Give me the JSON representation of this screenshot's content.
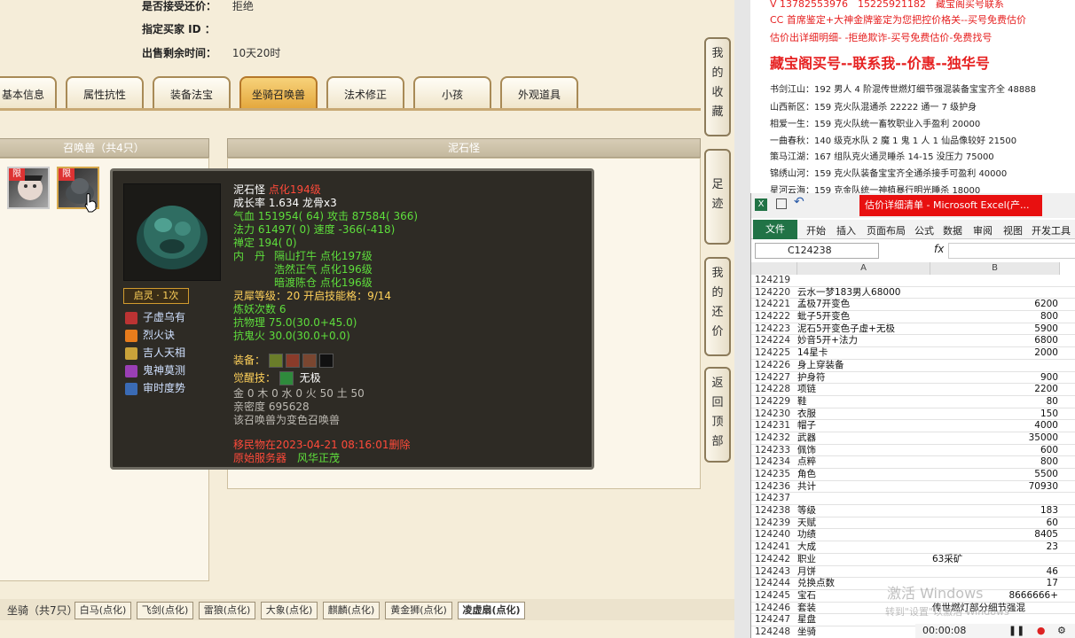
{
  "game": {
    "info": [
      {
        "label": "是否接受还价：",
        "value": "拒绝"
      },
      {
        "label": "指定买家 ID ：",
        "value": ""
      },
      {
        "label": "出售剩余时间：",
        "value": "10天20时"
      }
    ],
    "tabs": [
      "基本信息",
      "属性抗性",
      "装备法宝",
      "坐骑召唤兽",
      "法术修正",
      "小孩",
      "外观道具"
    ],
    "active_tab": "坐骑召唤兽",
    "left_panel_title": "召唤兽（共4只）",
    "right_panel_title": "泥石怪",
    "limit_badge": "限",
    "tooltip": {
      "name": "泥石怪",
      "level": "点化194级",
      "growth": "成长率 1.634 龙骨x3",
      "hp_label": "气血",
      "hp": "151954( 64)",
      "atk_label": "攻击",
      "atk": "87584( 366)",
      "mp_label": "法力",
      "mp": "61497( 0)",
      "spd_label": "速度",
      "spd": "-366(-418)",
      "def_label": "禅定",
      "def": "194( 0)",
      "neidan_label": "内　丹",
      "neidan": [
        "隔山打牛 点化197级",
        "浩然正气 点化196级",
        "暗渡陈仓 点化196级"
      ],
      "lingxi": "灵犀等级：20 开启技能格：9/14",
      "lianyao": "炼妖次数 6",
      "kang_wuli": "抗物理 75.0(30.0+45.0)",
      "kang_guihuo": "抗鬼火 30.0(30.0+0.0)",
      "qiling": "启灵 · 1次",
      "skills": [
        "子虚乌有",
        "烈火诀",
        "吉人天相",
        "鬼神莫测",
        "审时度势"
      ],
      "equip_label": "装备：",
      "awaken_label": "觉醒技：",
      "awaken": "无极",
      "elements": "金 0 木 0 水 0 火 50 土 50",
      "intimacy": "亲密度 695628",
      "note": "该召唤兽为变色召唤兽",
      "move_label": "移民物在",
      "move_time": "2023-04-21 08:16:01",
      "move_suffix": "删除",
      "server_label": "原始服务器",
      "server": "风华正茂"
    },
    "side_buttons": [
      "我的收藏",
      "足迹",
      "我的还价",
      "返回顶部"
    ],
    "bottom_label": "坐骑（共7只）",
    "bottom_tabs": [
      "白马(点化)",
      "飞剑(点化)",
      "雷狼(点化)",
      "大象(点化)",
      "麒麟(点化)",
      "黄金狮(点化)",
      "凌虚扇(点化)"
    ],
    "bottom_active": "凌虚扇(点化)"
  },
  "right": {
    "lines_top": [
      "V 13782553976　15225921182　藏宝阁买号联系",
      "CC 首席鉴定+大神金牌鉴定为您把控价格关--买号免费估价",
      "估价出详细明细- -拒绝欺诈-买号免费估价-免费找号"
    ],
    "headline": "藏宝阁买号--联系我--价惠--独华号",
    "list": [
      "书剑江山：192 男人 4 阶混传世燃灯细节强混装备宝宝齐全 48888",
      "山西新区：159 克火队混通杀 22222 通一 7 级护身",
      "相爱一生：159 克火队统一畜牧职业入手盈利 20000",
      "一曲春秋：140 级克水队 2 魔 1 鬼 1 人 1 仙品像较好 21500",
      "策马江湖：167 组队克火通灵睡杀 14-15 没压力 75000",
      "锦绣山河：159 克火队装备宝宝齐全通杀接手可盈利 40000",
      "星河云海：159 克金队统一神植暴行明光睡杀 18000"
    ]
  },
  "excel": {
    "title": "估价详细清单 - Microsoft Excel(产...",
    "file_label": "文件",
    "menus": [
      "开始",
      "插入",
      "页面布局",
      "公式",
      "数据",
      "审阅",
      "视图",
      "开发工具"
    ],
    "name_box": "C124238",
    "fx": "fx",
    "col_a": "A",
    "col_b": "B",
    "rows": [
      {
        "n": "124219",
        "a": "",
        "b": ""
      },
      {
        "n": "124220",
        "a": "云水一梦183男人68000",
        "b": ""
      },
      {
        "n": "124221",
        "a": "孟极7开变色",
        "b": "6200"
      },
      {
        "n": "124222",
        "a": "蚍子5开变色",
        "b": "800"
      },
      {
        "n": "124223",
        "a": "泥石5开变色子虚+无极",
        "b": "5900"
      },
      {
        "n": "124224",
        "a": "妙音5开+法力",
        "b": "6800"
      },
      {
        "n": "124225",
        "a": "14星卡",
        "b": "2000"
      },
      {
        "n": "124226",
        "a": "身上穿装备",
        "b": ""
      },
      {
        "n": "124227",
        "a": "护身符",
        "b": "900"
      },
      {
        "n": "124228",
        "a": "项链",
        "b": "2200"
      },
      {
        "n": "124229",
        "a": "鞋",
        "b": "80"
      },
      {
        "n": "124230",
        "a": "衣服",
        "b": "150"
      },
      {
        "n": "124231",
        "a": "帽子",
        "b": "4000"
      },
      {
        "n": "124232",
        "a": "武器",
        "b": "35000"
      },
      {
        "n": "124233",
        "a": "佩饰",
        "b": "600"
      },
      {
        "n": "124234",
        "a": "点粹",
        "b": "800"
      },
      {
        "n": "124235",
        "a": "角色",
        "b": "5500"
      },
      {
        "n": "124236",
        "a": "共计",
        "b": "70930"
      },
      {
        "n": "124237",
        "a": "",
        "b": ""
      },
      {
        "n": "124238",
        "a": "等级",
        "b": "183"
      },
      {
        "n": "124239",
        "a": "天赋",
        "b": "60"
      },
      {
        "n": "124240",
        "a": "功绩",
        "b": "8405"
      },
      {
        "n": "124241",
        "a": "大成",
        "b": "23"
      },
      {
        "n": "124242",
        "a": "职业",
        "b": "63采矿"
      },
      {
        "n": "124243",
        "a": "月饼",
        "b": "46"
      },
      {
        "n": "124244",
        "a": "兑换点数",
        "b": "17"
      },
      {
        "n": "124245",
        "a": "宝石",
        "b": "8666666+"
      },
      {
        "n": "124246",
        "a": "套装",
        "b": "传世燃灯部分细节强混"
      },
      {
        "n": "124247",
        "a": "星盘",
        "b": ""
      },
      {
        "n": "124248",
        "a": "坐骑",
        "b": ""
      }
    ],
    "watermark": "激活 Windows",
    "watermark_sub": "转到\"设置\"以激活 Windows",
    "rec_time": "00:00:08"
  }
}
